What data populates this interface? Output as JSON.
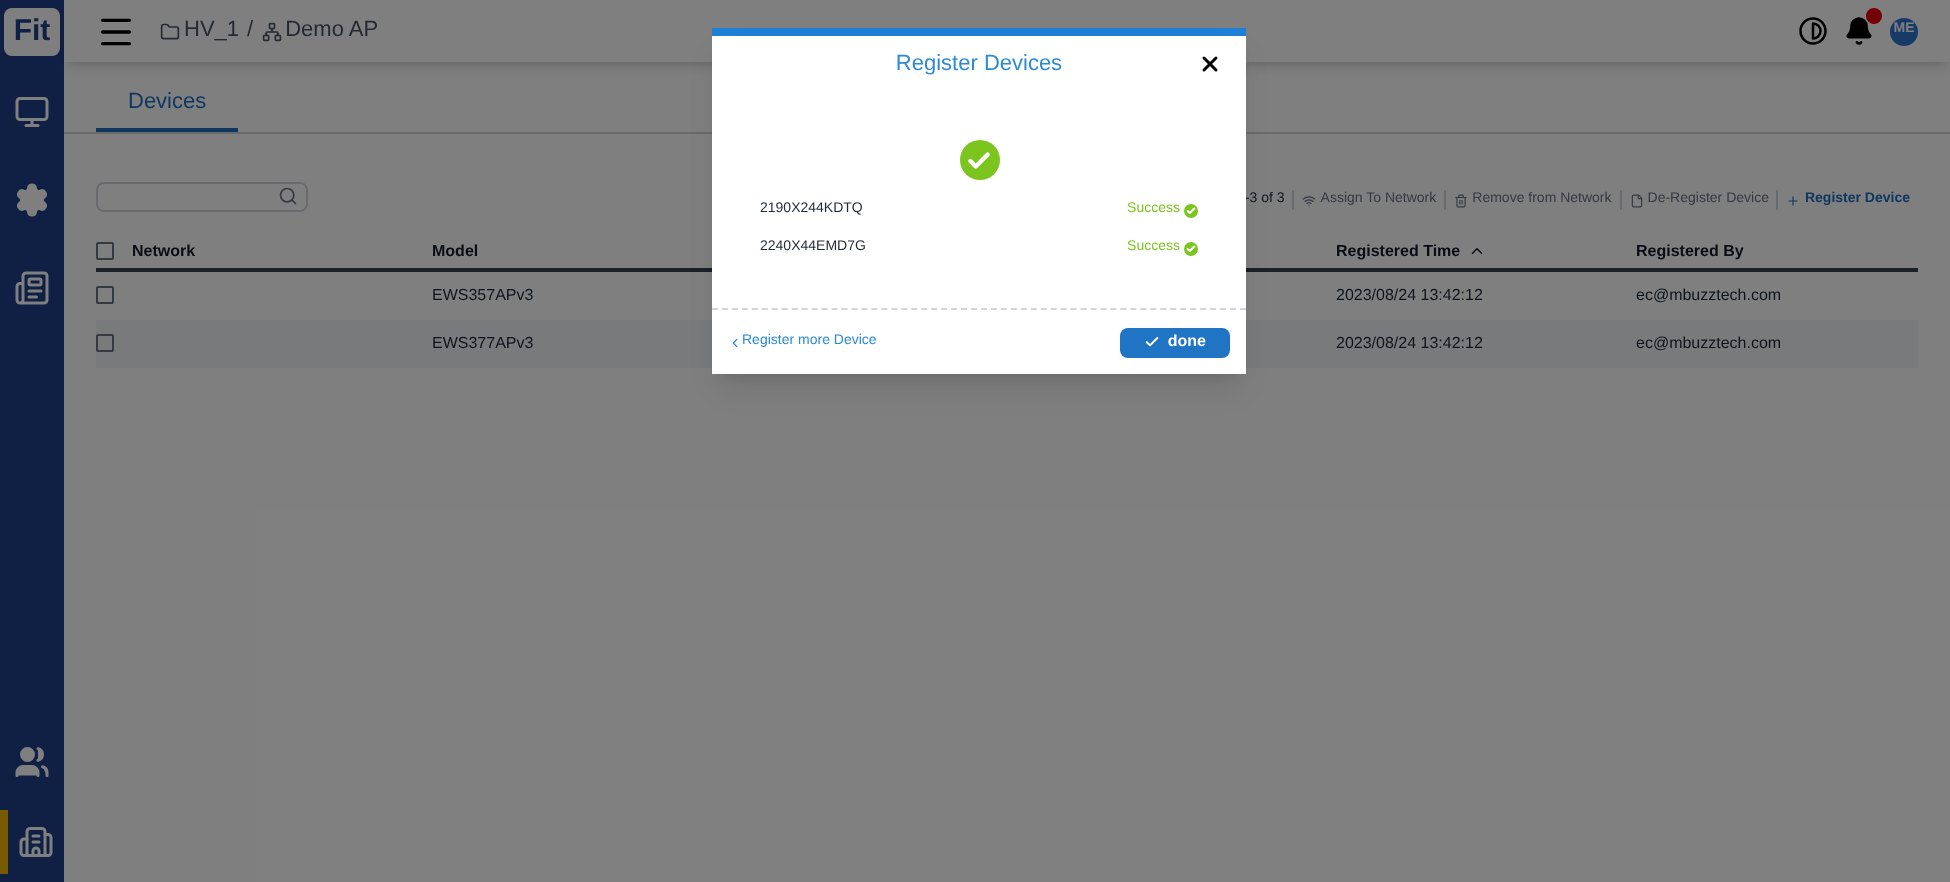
{
  "header": {
    "breadcrumb": [
      {
        "kind": "folder",
        "label": "HV_1"
      },
      {
        "kind": "network",
        "label": "Demo AP"
      }
    ],
    "separator": "/",
    "avatar": "ME"
  },
  "sidebar": {
    "logo": "Fit",
    "items": [
      {
        "kind": "monitor",
        "selected": false
      },
      {
        "kind": "gear",
        "selected": false
      },
      {
        "kind": "list",
        "selected": false
      }
    ],
    "bottom_items": [
      {
        "kind": "users",
        "selected": false
      },
      {
        "kind": "building",
        "selected": true
      }
    ]
  },
  "tabs": [
    {
      "label": "Devices",
      "selected": true
    }
  ],
  "toolbar": {
    "pagination": "-3 of 3",
    "actions": [
      {
        "kind": "wifi",
        "label": "Assign To Network",
        "disabled": true
      },
      {
        "kind": "trash",
        "label": "Remove from Network",
        "disabled": true
      },
      {
        "kind": "file",
        "label": "De-Register Device",
        "disabled": true
      },
      {
        "kind": "plus",
        "label": "Register Device",
        "disabled": false
      }
    ]
  },
  "table": {
    "all_checked": false,
    "columns": [
      {
        "label": "Network",
        "sorted": false
      },
      {
        "label": "Model",
        "sorted": false
      },
      {
        "label": "Registered Time",
        "sorted": true
      },
      {
        "label": "Registered By",
        "sorted": false
      }
    ],
    "rows": [
      {
        "checked": false,
        "network": "",
        "model": "EWS357APv3",
        "registered_time": "2023/08/24 13:42:12",
        "registered_by": "ec@mbuzztech.com"
      },
      {
        "checked": false,
        "network": "",
        "model": "EWS377APv3",
        "registered_time": "2023/08/24 13:42:12",
        "registered_by": "ec@mbuzztech.com"
      }
    ]
  },
  "dialog": {
    "title": "Register Devices",
    "results": [
      {
        "serial": "2190X244KDTQ",
        "status": "Success"
      },
      {
        "serial": "2240X44EMD7G",
        "status": "Success"
      }
    ],
    "back_link": "Register more Device",
    "done_button": "done"
  }
}
